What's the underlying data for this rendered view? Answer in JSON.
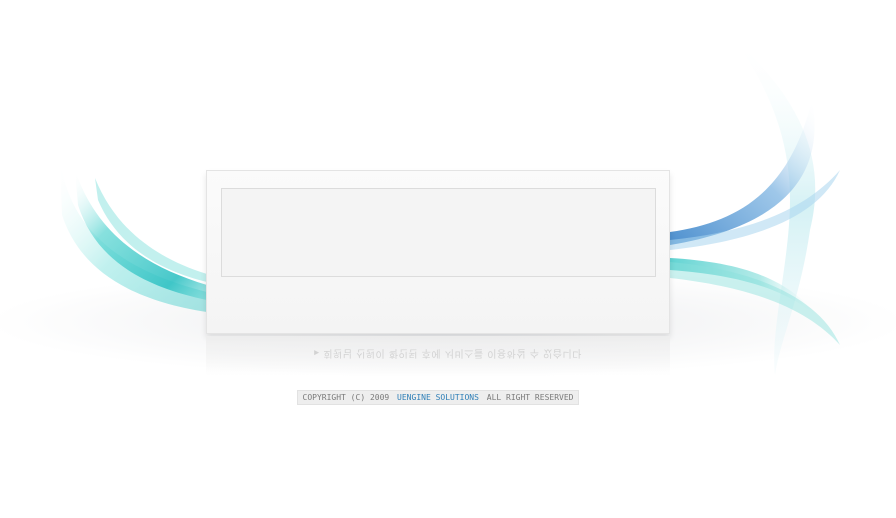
{
  "notice": {
    "text": "▸ 회원님 신원이 확인된 후에 서비스를 이용하실 수 있습니다"
  },
  "footer": {
    "prefix": "COPYRIGHT (C) 2009",
    "brand": "UENGINE SOLUTIONS",
    "suffix": "ALL RIGHT RESERVED"
  },
  "colors": {
    "teal_swoosh": "#3ec9c9",
    "blue_swoosh": "#3c83c9",
    "brand_text": "#2f7fb7"
  }
}
